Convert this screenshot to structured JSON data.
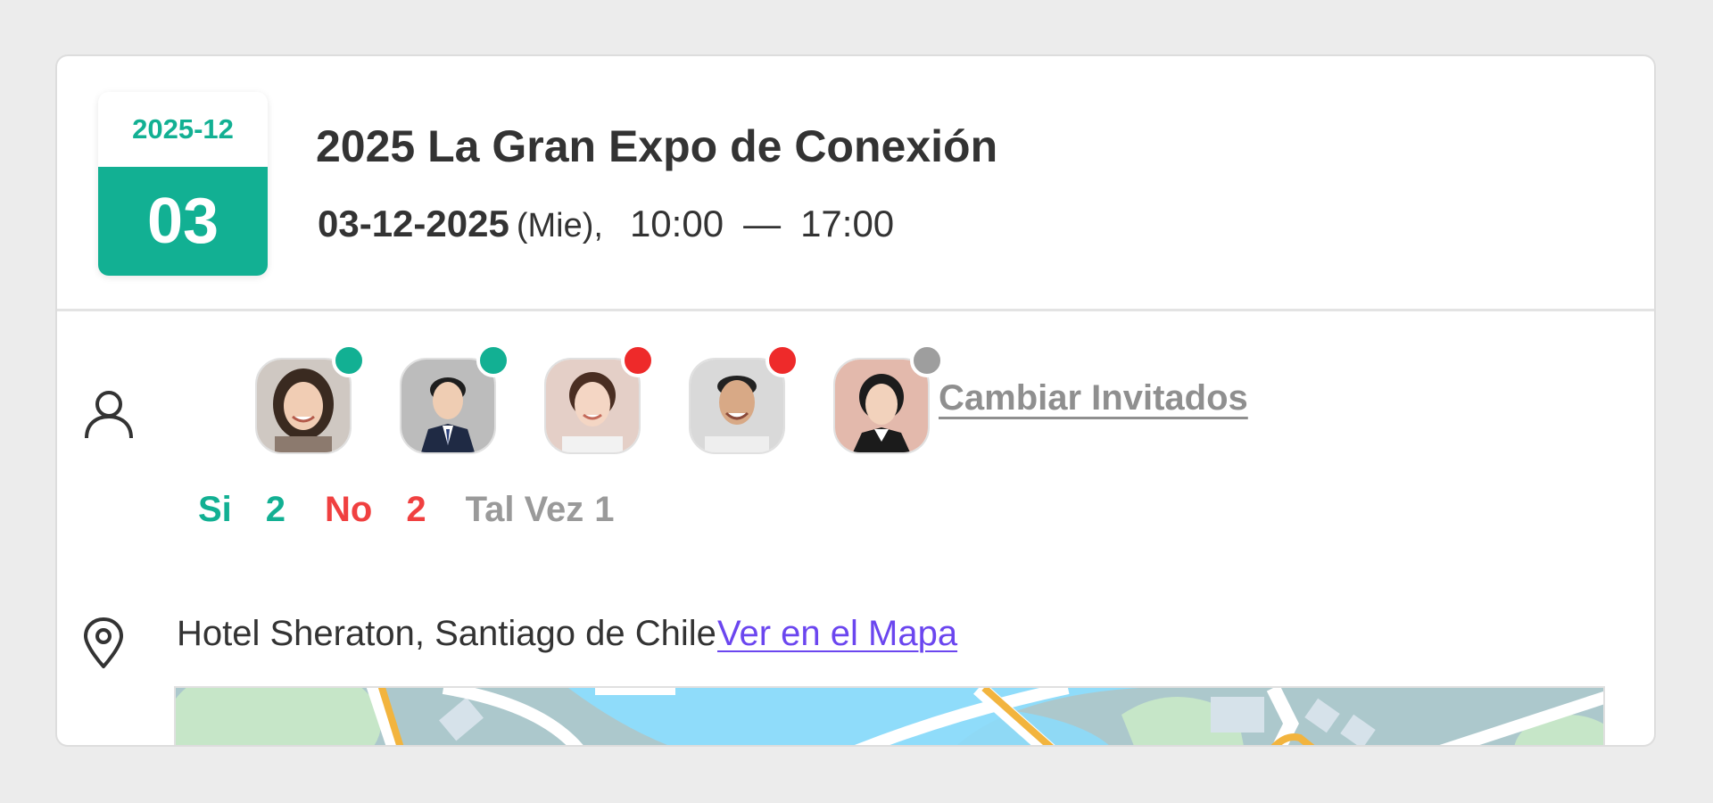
{
  "event": {
    "badge_month": "2025-12",
    "badge_day": "03",
    "title": "2025 La Gran Expo de Conexión",
    "date": "03-12-2025",
    "weekday": "(Mie),",
    "start_time": "10:00",
    "dash": "—",
    "end_time": "17:00"
  },
  "guests": {
    "icon": "person-icon",
    "change_label": "Cambiar Invitados",
    "avatars": [
      {
        "status": "yes",
        "status_color": "#12b093"
      },
      {
        "status": "yes",
        "status_color": "#12b093"
      },
      {
        "status": "no",
        "status_color": "#ee2a2a"
      },
      {
        "status": "no",
        "status_color": "#ee2a2a"
      },
      {
        "status": "maybe",
        "status_color": "#9e9e9e"
      }
    ]
  },
  "rsvp": {
    "yes_label": "Si",
    "yes_count": "2",
    "no_label": "No",
    "no_count": "2",
    "maybe_label": "Tal Vez",
    "maybe_count": "1"
  },
  "location": {
    "icon": "map-pin-icon",
    "address": "Hotel Sheraton, Santiago de Chile",
    "map_link": "Ver en el Mapa"
  },
  "colors": {
    "accent": "#12b093",
    "no": "#f04040",
    "maybe": "#9a9a9a",
    "link": "#6b46ef"
  }
}
